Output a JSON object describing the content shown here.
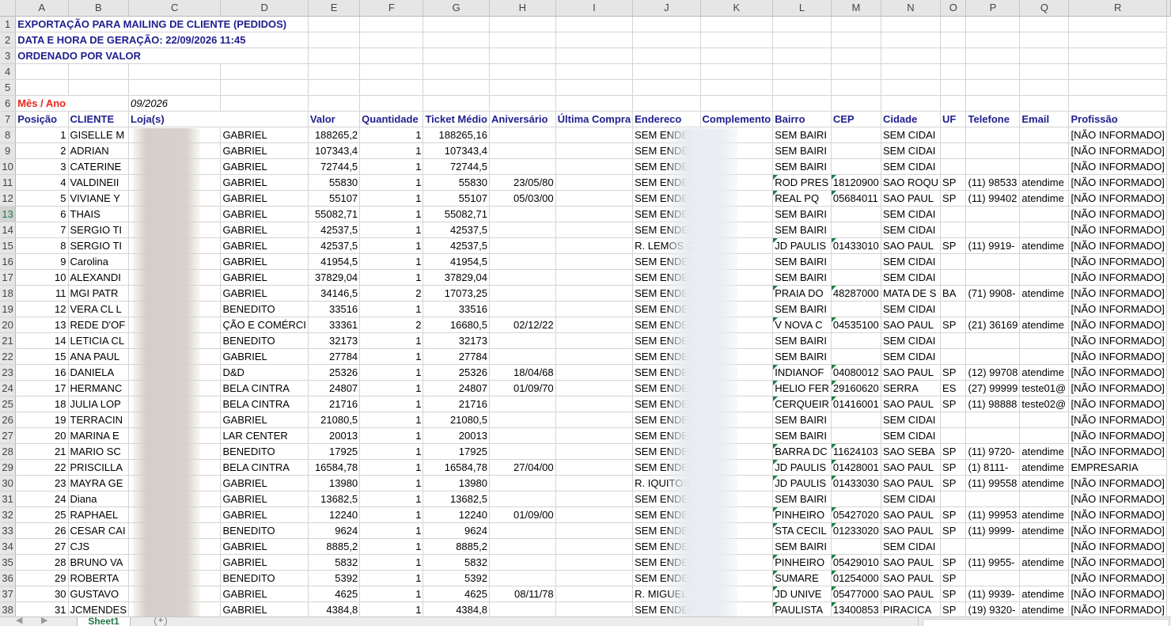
{
  "columns": [
    "A",
    "B",
    "C",
    "D",
    "E",
    "F",
    "G",
    "H",
    "I",
    "J",
    "K",
    "L",
    "M",
    "N",
    "O",
    "P",
    "Q",
    "R"
  ],
  "info": {
    "line1": "EXPORTAÇÃO PARA MAILING DE CLIENTE (PEDIDOS)",
    "line2": "DATA E HORA DE GERAÇÃO: 22/09/2026 11:45",
    "line3": "ORDENADO POR VALOR",
    "period_label": "Mês / Ano",
    "period_value": "09/2026"
  },
  "headers": [
    "Posição",
    "CLIENTE",
    "Loja(s)",
    "Valor",
    "Quantidade",
    "Ticket Médio",
    "Aniversário",
    "Última Compra",
    "Endereco",
    "Complemento",
    "Bairro",
    "CEP",
    "Cidade",
    "UF",
    "Telefone",
    "Email",
    "Profissão"
  ],
  "selected_row": 13,
  "rows": [
    {
      "pos": "1",
      "cliente": "GISELLE M",
      "loja": "GABRIEL",
      "valor": "188265,2",
      "qtd": "1",
      "ticket": "188265,16",
      "aniv": "",
      "ult": "",
      "end": "SEM ENDEI",
      "comp": "",
      "bairro": "SEM BAIRI",
      "cep": "",
      "cidade": "SEM CIDAI",
      "uf": "",
      "tel": "",
      "email": "",
      "prof": "[NÃO INFORMADO]"
    },
    {
      "pos": "2",
      "cliente": "ADRIAN",
      "loja": "GABRIEL",
      "valor": "107343,4",
      "qtd": "1",
      "ticket": "107343,4",
      "aniv": "",
      "ult": "",
      "end": "SEM ENDEI",
      "comp": "",
      "bairro": "SEM BAIRI",
      "cep": "",
      "cidade": "SEM CIDAI",
      "uf": "",
      "tel": "",
      "email": "",
      "prof": "[NÃO INFORMADO]"
    },
    {
      "pos": "3",
      "cliente": "CATERINE",
      "loja": "GABRIEL",
      "valor": "72744,5",
      "qtd": "1",
      "ticket": "72744,5",
      "aniv": "",
      "ult": "",
      "end": "SEM ENDEI",
      "comp": "",
      "bairro": "SEM BAIRI",
      "cep": "",
      "cidade": "SEM CIDAI",
      "uf": "",
      "tel": "",
      "email": "",
      "prof": "[NÃO INFORMADO]"
    },
    {
      "pos": "4",
      "cliente": "VALDINEII",
      "loja": "GABRIEL",
      "valor": "55830",
      "qtd": "1",
      "ticket": "55830",
      "aniv": "23/05/80",
      "ult": "",
      "end": "SEM ENDEI",
      "comp": "",
      "bairro": "ROD PRES",
      "cep": "18120900",
      "cidade": "SAO ROQU",
      "uf": "SP",
      "tel": "(11) 98533",
      "email": "atendime",
      "prof": "[NÃO INFORMADO]"
    },
    {
      "pos": "5",
      "cliente": "VIVIANE Y",
      "loja": "GABRIEL",
      "valor": "55107",
      "qtd": "1",
      "ticket": "55107",
      "aniv": "05/03/00",
      "ult": "",
      "end": "SEM ENDEI",
      "comp": "",
      "bairro": "REAL PQ",
      "cep": "05684011",
      "cidade": "SAO PAUL",
      "uf": "SP",
      "tel": "(11) 99402",
      "email": "atendime",
      "prof": "[NÃO INFORMADO]"
    },
    {
      "pos": "6",
      "cliente": "THAIS",
      "loja": "GABRIEL",
      "valor": "55082,71",
      "qtd": "1",
      "ticket": "55082,71",
      "aniv": "",
      "ult": "",
      "end": "SEM ENDEI",
      "comp": "",
      "bairro": "SEM BAIRI",
      "cep": "",
      "cidade": "SEM CIDAI",
      "uf": "",
      "tel": "",
      "email": "",
      "prof": "[NÃO INFORMADO]"
    },
    {
      "pos": "7",
      "cliente": "SERGIO TI",
      "loja": "GABRIEL",
      "valor": "42537,5",
      "qtd": "1",
      "ticket": "42537,5",
      "aniv": "",
      "ult": "",
      "end": "SEM ENDEI",
      "comp": "",
      "bairro": "SEM BAIRI",
      "cep": "",
      "cidade": "SEM CIDAI",
      "uf": "",
      "tel": "",
      "email": "",
      "prof": "[NÃO INFORMADO]"
    },
    {
      "pos": "8",
      "cliente": "SERGIO TI",
      "loja": "GABRIEL",
      "valor": "42537,5",
      "qtd": "1",
      "ticket": "42537,5",
      "aniv": "",
      "ult": "",
      "end": "R. LEMOS C",
      "comp": "",
      "bairro": "JD PAULIS",
      "cep": "01433010",
      "cidade": "SAO PAUL",
      "uf": "SP",
      "tel": "(11) 9919-",
      "email": "atendime",
      "prof": "[NÃO INFORMADO]"
    },
    {
      "pos": "9",
      "cliente": "Carolina",
      "loja": "GABRIEL",
      "valor": "41954,5",
      "qtd": "1",
      "ticket": "41954,5",
      "aniv": "",
      "ult": "",
      "end": "SEM ENDEI",
      "comp": "",
      "bairro": "SEM BAIRI",
      "cep": "",
      "cidade": "SEM CIDAI",
      "uf": "",
      "tel": "",
      "email": "",
      "prof": "[NÃO INFORMADO]"
    },
    {
      "pos": "10",
      "cliente": "ALEXANDI",
      "loja": "GABRIEL",
      "valor": "37829,04",
      "qtd": "1",
      "ticket": "37829,04",
      "aniv": "",
      "ult": "",
      "end": "SEM ENDEI",
      "comp": "",
      "bairro": "SEM BAIRI",
      "cep": "",
      "cidade": "SEM CIDAI",
      "uf": "",
      "tel": "",
      "email": "",
      "prof": "[NÃO INFORMADO]"
    },
    {
      "pos": "11",
      "cliente": "MGI PATR",
      "loja": "GABRIEL",
      "valor": "34146,5",
      "qtd": "2",
      "ticket": "17073,25",
      "aniv": "",
      "ult": "",
      "end": "SEM ENDEI",
      "comp": "",
      "bairro": "PRAIA DO",
      "cep": "48287000",
      "cidade": "MATA DE S",
      "uf": "BA",
      "tel": "(71) 9908-",
      "email": "atendime",
      "prof": "[NÃO INFORMADO]"
    },
    {
      "pos": "12",
      "cliente": "VERA CL L",
      "loja": "BENEDITO",
      "valor": "33516",
      "qtd": "1",
      "ticket": "33516",
      "aniv": "",
      "ult": "",
      "end": "SEM ENDEI",
      "comp": "",
      "bairro": "SEM BAIRI",
      "cep": "",
      "cidade": "SEM CIDAI",
      "uf": "",
      "tel": "",
      "email": "",
      "prof": "[NÃO INFORMADO]"
    },
    {
      "pos": "13",
      "cliente": "REDE D'OF",
      "loja": "ÇÃO E COMÉRCI",
      "valor": "33361",
      "qtd": "2",
      "ticket": "16680,5",
      "aniv": "02/12/22",
      "ult": "",
      "end": "SEM ENDEI",
      "comp": "",
      "bairro": "V NOVA C",
      "cep": "04535100",
      "cidade": "SAO PAUL",
      "uf": "SP",
      "tel": "(21) 36169",
      "email": "atendime",
      "prof": "[NÃO INFORMADO]"
    },
    {
      "pos": "14",
      "cliente": "LETICIA CL",
      "loja": "BENEDITO",
      "valor": "32173",
      "qtd": "1",
      "ticket": "32173",
      "aniv": "",
      "ult": "",
      "end": "SEM ENDEI",
      "comp": "",
      "bairro": "SEM BAIRI",
      "cep": "",
      "cidade": "SEM CIDAI",
      "uf": "",
      "tel": "",
      "email": "",
      "prof": "[NÃO INFORMADO]"
    },
    {
      "pos": "15",
      "cliente": "ANA PAUL",
      "loja": "GABRIEL",
      "valor": "27784",
      "qtd": "1",
      "ticket": "27784",
      "aniv": "",
      "ult": "",
      "end": "SEM ENDEI",
      "comp": "",
      "bairro": "SEM BAIRI",
      "cep": "",
      "cidade": "SEM CIDAI",
      "uf": "",
      "tel": "",
      "email": "",
      "prof": "[NÃO INFORMADO]"
    },
    {
      "pos": "16",
      "cliente": "DANIELA",
      "loja": "D&D",
      "valor": "25326",
      "qtd": "1",
      "ticket": "25326",
      "aniv": "18/04/68",
      "ult": "",
      "end": "SEM ENDEI",
      "comp": "",
      "bairro": "INDIANOF",
      "cep": "04080012",
      "cidade": "SAO PAUL",
      "uf": "SP",
      "tel": "(12) 99708",
      "email": "atendime",
      "prof": "[NÃO INFORMADO]"
    },
    {
      "pos": "17",
      "cliente": "HERMANC",
      "loja": "BELA CINTRA",
      "valor": "24807",
      "qtd": "1",
      "ticket": "24807",
      "aniv": "01/09/70",
      "ult": "",
      "end": "SEM ENDEI",
      "comp": "",
      "bairro": "HELIO FER",
      "cep": "29160620",
      "cidade": "SERRA",
      "uf": "ES",
      "tel": "(27) 99999",
      "email": "teste01@",
      "prof": "[NÃO INFORMADO]"
    },
    {
      "pos": "18",
      "cliente": "JULIA LOP",
      "loja": "BELA CINTRA",
      "valor": "21716",
      "qtd": "1",
      "ticket": "21716",
      "aniv": "",
      "ult": "",
      "end": "SEM ENDEI",
      "comp": "",
      "bairro": "CERQUEIR",
      "cep": "01416001",
      "cidade": "SAO PAUL",
      "uf": "SP",
      "tel": "(11) 98888",
      "email": "teste02@",
      "prof": "[NÃO INFORMADO]"
    },
    {
      "pos": "19",
      "cliente": "TERRACIN",
      "loja": "GABRIEL",
      "valor": "21080,5",
      "qtd": "1",
      "ticket": "21080,5",
      "aniv": "",
      "ult": "",
      "end": "SEM ENDEI",
      "comp": "",
      "bairro": "SEM BAIRI",
      "cep": "",
      "cidade": "SEM CIDAI",
      "uf": "",
      "tel": "",
      "email": "",
      "prof": "[NÃO INFORMADO]"
    },
    {
      "pos": "20",
      "cliente": "MARINA E",
      "loja": "LAR CENTER",
      "valor": "20013",
      "qtd": "1",
      "ticket": "20013",
      "aniv": "",
      "ult": "",
      "end": "SEM ENDEI",
      "comp": "",
      "bairro": "SEM BAIRI",
      "cep": "",
      "cidade": "SEM CIDAI",
      "uf": "",
      "tel": "",
      "email": "",
      "prof": "[NÃO INFORMADO]"
    },
    {
      "pos": "21",
      "cliente": "MARIO SC",
      "loja": "BENEDITO",
      "valor": "17925",
      "qtd": "1",
      "ticket": "17925",
      "aniv": "",
      "ult": "",
      "end": "SEM ENDEI",
      "comp": "",
      "bairro": "BARRA DC",
      "cep": "11624103",
      "cidade": "SAO SEBA",
      "uf": "SP",
      "tel": "(11) 9720-",
      "email": "atendime",
      "prof": "[NÃO INFORMADO]"
    },
    {
      "pos": "22",
      "cliente": "PRISCILLA",
      "loja": "BELA CINTRA",
      "valor": "16584,78",
      "qtd": "1",
      "ticket": "16584,78",
      "aniv": "27/04/00",
      "ult": "",
      "end": "SEM ENDEI",
      "comp": "",
      "bairro": "JD PAULIS",
      "cep": "01428001",
      "cidade": "SAO PAUL",
      "uf": "SP",
      "tel": "(1) 8111-",
      "email": "atendime",
      "prof": "EMPRESARIA"
    },
    {
      "pos": "23",
      "cliente": "MAYRA GE",
      "loja": "GABRIEL",
      "valor": "13980",
      "qtd": "1",
      "ticket": "13980",
      "aniv": "",
      "ult": "",
      "end": "R. IQUITOS",
      "comp": "",
      "bairro": "JD PAULIS",
      "cep": "01433030",
      "cidade": "SAO PAUL",
      "uf": "SP",
      "tel": "(11) 99558",
      "email": "atendime",
      "prof": "[NÃO INFORMADO]"
    },
    {
      "pos": "24",
      "cliente": "Diana",
      "loja": "GABRIEL",
      "valor": "13682,5",
      "qtd": "1",
      "ticket": "13682,5",
      "aniv": "",
      "ult": "",
      "end": "SEM ENDEI",
      "comp": "",
      "bairro": "SEM BAIRI",
      "cep": "",
      "cidade": "SEM CIDAI",
      "uf": "",
      "tel": "",
      "email": "",
      "prof": "[NÃO INFORMADO]"
    },
    {
      "pos": "25",
      "cliente": "RAPHAEL",
      "loja": "GABRIEL",
      "valor": "12240",
      "qtd": "1",
      "ticket": "12240",
      "aniv": "01/09/00",
      "ult": "",
      "end": "SEM ENDEI",
      "comp": "",
      "bairro": "PINHEIRO",
      "cep": "05427020",
      "cidade": "SAO PAUL",
      "uf": "SP",
      "tel": "(11) 99953",
      "email": "atendime",
      "prof": "[NÃO INFORMADO]"
    },
    {
      "pos": "26",
      "cliente": "CESAR CAI",
      "loja": "BENEDITO",
      "valor": "9624",
      "qtd": "1",
      "ticket": "9624",
      "aniv": "",
      "ult": "",
      "end": "SEM ENDEI",
      "comp": "",
      "bairro": "STA CECIL",
      "cep": "01233020",
      "cidade": "SAO PAUL",
      "uf": "SP",
      "tel": "(11) 9999-",
      "email": "atendime",
      "prof": "[NÃO INFORMADO]"
    },
    {
      "pos": "27",
      "cliente": "CJS",
      "loja": "GABRIEL",
      "valor": "8885,2",
      "qtd": "1",
      "ticket": "8885,2",
      "aniv": "",
      "ult": "",
      "end": "SEM ENDEI",
      "comp": "",
      "bairro": "SEM BAIRI",
      "cep": "",
      "cidade": "SEM CIDAI",
      "uf": "",
      "tel": "",
      "email": "",
      "prof": "[NÃO INFORMADO]"
    },
    {
      "pos": "28",
      "cliente": "BRUNO VA",
      "loja": "GABRIEL",
      "valor": "5832",
      "qtd": "1",
      "ticket": "5832",
      "aniv": "",
      "ult": "",
      "end": "SEM ENDEI",
      "comp": "",
      "bairro": "PINHEIRO",
      "cep": "05429010",
      "cidade": "SAO PAUL",
      "uf": "SP",
      "tel": "(11) 9955-",
      "email": "atendime",
      "prof": "[NÃO INFORMADO]"
    },
    {
      "pos": "29",
      "cliente": "ROBERTA",
      "loja": "BENEDITO",
      "valor": "5392",
      "qtd": "1",
      "ticket": "5392",
      "aniv": "",
      "ult": "",
      "end": "SEM ENDEI",
      "comp": "",
      "bairro": "SUMARE",
      "cep": "01254000",
      "cidade": "SAO PAUL",
      "uf": "SP",
      "tel": "",
      "email": "",
      "prof": "[NÃO INFORMADO]"
    },
    {
      "pos": "30",
      "cliente": "GUSTAVO",
      "loja": "GABRIEL",
      "valor": "4625",
      "qtd": "1",
      "ticket": "4625",
      "aniv": "08/11/78",
      "ult": "",
      "end": "R. MIGUEL",
      "comp": "",
      "bairro": "JD UNIVE",
      "cep": "05477000",
      "cidade": "SAO PAUL",
      "uf": "SP",
      "tel": "(11) 9939-",
      "email": "atendime",
      "prof": "[NÃO INFORMADO]"
    },
    {
      "pos": "31",
      "cliente": "JCMENDES",
      "loja": "GABRIEL",
      "valor": "4384,8",
      "qtd": "1",
      "ticket": "4384,8",
      "aniv": "",
      "ult": "",
      "end": "SEM ENDEI",
      "comp": "",
      "bairro": "PAULISTA",
      "cep": "13400853",
      "cidade": "PIRACICA",
      "uf": "SP",
      "tel": "(19) 9320-",
      "email": "atendime",
      "prof": "[NÃO INFORMADO]"
    }
  ],
  "sheet_tab": "Sheet1",
  "add_sheet_icon": "+",
  "nav_prev_icon": "◀",
  "nav_next_icon": "▶"
}
